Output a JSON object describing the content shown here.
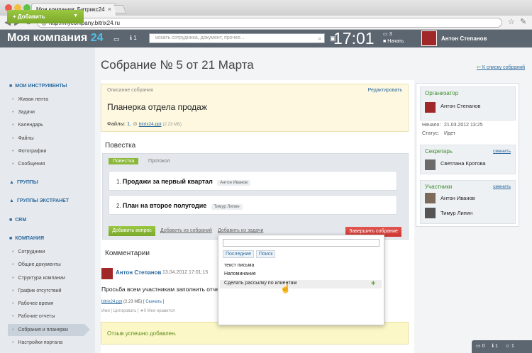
{
  "browser": {
    "tab_title": "Моя компания: Битрикс24",
    "url": "http://mycompany.bitrix24.ru"
  },
  "header": {
    "company_name": "Моя компания",
    "company_num": "24",
    "msg_count": "1",
    "search_placeholder": "искать сотрудника, документ, прочее...",
    "clock": "17:01",
    "counter": "3",
    "start_label": "Начать",
    "user_name": "Антон Степанов"
  },
  "sidebar": {
    "add_label": "Добавить",
    "my_tools": "МОИ ИНСТРУМЕНТЫ",
    "tools": [
      "Живая лента",
      "Задачи",
      "Календарь",
      "Файлы",
      "Фотографии",
      "Сообщения"
    ],
    "groups": "ГРУППЫ",
    "extranet": "ГРУППЫ ЭКСТРАНЕТ",
    "crm": "CRM",
    "company": "КОМПАНИЯ",
    "company_items": [
      "Сотрудники",
      "Общие документы",
      "Структура компании",
      "График отсутствий",
      "Рабочее время",
      "Рабочие отчеты",
      "Собрания и планерки",
      "Настройки портала"
    ]
  },
  "page": {
    "title": "Собрание № 5 от 21 Марта",
    "back_link": "К списку собраний",
    "desc_label": "Описание собрания",
    "edit_link": "Редактировать",
    "meeting_name": "Планерка отдела продаж",
    "files_label": "Файлы:",
    "file_num": "1.",
    "file_name": "bitrix24.ppt",
    "file_size": "(2.23 МБ)",
    "agenda_title": "Повестка",
    "tab_agenda": "Повестка",
    "tab_protocol": "Протокол",
    "agenda_items": [
      {
        "num": "1.",
        "title": "Продажи за первый квартал",
        "person": "Антон Иванов"
      },
      {
        "num": "2.",
        "title": "План на второе полугодие",
        "person": "Тимур Липин"
      }
    ],
    "btn_add_question": "Добавить вопрос",
    "link_add_from_meetings": "Добавить из собраний",
    "link_add_from_tasks": "Добавить из задачи",
    "btn_finish": "Завершить собрание",
    "comments_title": "Комментарии",
    "comment": {
      "author": "Антон Степанов",
      "date": "13.04.2012 17:01:15",
      "text": "Просьба всем участникам заполнить отчеты",
      "file": "bitrix24.ppt",
      "file_size": "(2.23 МБ)",
      "download": "Скачать",
      "action_name": "Имя",
      "action_quote": "Цитировать",
      "action_like": "0 Мне нравится"
    },
    "success": "Отзыв успешно добавлен."
  },
  "popup": {
    "tab_recent": "Последние",
    "tab_search": "Поиск",
    "items": [
      "текст письма",
      "Напоминание",
      "Сделать рассылку по клиентам"
    ]
  },
  "right": {
    "organizer_title": "Организатор",
    "organizer_name": "Антон Степанов",
    "start_label": "Начало:",
    "start_value": "21.03.2012 13:25",
    "status_label": "Статус:",
    "status_value": "Идет",
    "secretary_title": "Секретарь",
    "change_link": "сменить",
    "secretary_name": "Светлана Кротова",
    "participants_title": "Участники",
    "participants": [
      "Антон Иванов",
      "Тимур Липин"
    ]
  },
  "bottom_bar": {
    "a": "0",
    "b": "1",
    "c": "1"
  },
  "colors": {
    "header_bg": "#5c6670",
    "accent_green": "#8bb83a",
    "link_blue": "#2b6aa0",
    "finish_red": "#d9443e"
  }
}
